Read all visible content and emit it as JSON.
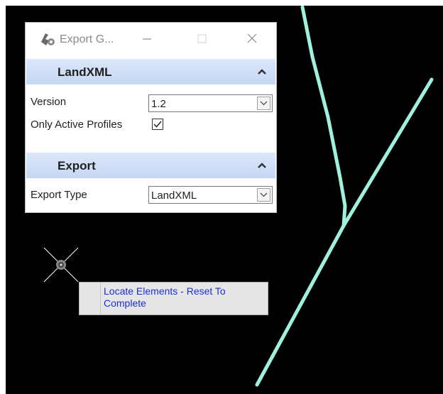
{
  "dialog": {
    "title": "Export G...",
    "icon": "export-geometry-icon",
    "sections": {
      "landxml": {
        "title": "LandXML",
        "version_label": "Version",
        "version_value": "1.2",
        "only_active_profiles_label": "Only Active Profiles",
        "only_active_profiles_checked": true
      },
      "export": {
        "title": "Export",
        "export_type_label": "Export Type",
        "export_type_value": "LandXML"
      }
    }
  },
  "tooltip": {
    "text": "Locate Elements - Reset To Complete"
  },
  "colors": {
    "canvas": "#000000",
    "element_line": "#9ff0dc",
    "section_header": "#c9daf5",
    "tooltip_text": "#1c2fd6"
  }
}
